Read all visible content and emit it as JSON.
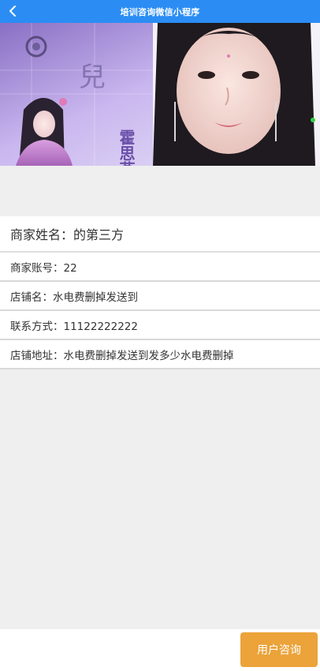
{
  "navbar": {
    "title": "培训咨询微信小程序",
    "back_icon": "chevron-left-icon"
  },
  "banner": {
    "overlay_text_1": "霍思燕",
    "overlay_text_2": "兒"
  },
  "merchant": {
    "name_label": "商家姓名：的第三方",
    "account_label": "商家账号：22",
    "shop_label": "店铺名：水电费删掉发送到",
    "contact_label": "联系方式：11122222222",
    "address_label": "店铺地址：水电费删掉发送到发多少水电费删掉"
  },
  "footer": {
    "consult_button": "用户咨询"
  },
  "colors": {
    "nav_bg": "#2b8df4",
    "button_bg": "#eba33a",
    "page_bg": "#efefef"
  }
}
